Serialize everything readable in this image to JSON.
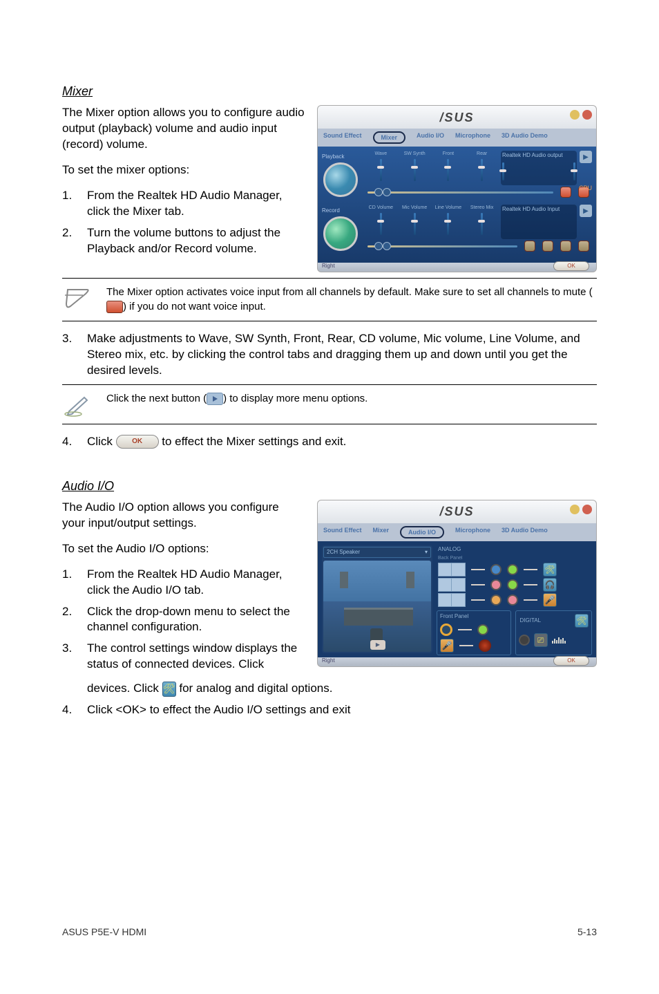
{
  "sections": {
    "mixer": {
      "title": "Mixer",
      "intro": "The Mixer option allows you to configure audio output (playback) volume and audio input (record) volume.",
      "to_set": "To set the mixer options:",
      "steps": [
        "From the Realtek HD Audio Manager, click the Mixer tab.",
        "Turn the volume buttons to adjust the Playback and/or Record volume."
      ],
      "note1": "The Mixer option activates voice input from all channels by default. Make sure to set all channels to mute (",
      "note1_tail": ") if you do not want voice input.",
      "step3": "Make adjustments to Wave, SW Synth, Front, Rear, CD volume, Mic volume, Line Volume, and Stereo mix, etc. by clicking the control tabs and dragging them up and down until you get the desired levels.",
      "note2": "Click the next button (",
      "note2_tail": ") to display more menu options.",
      "step4a": "Click ",
      "step4b": " to effect the Mixer settings and exit."
    },
    "audio_io": {
      "title": "Audio I/O",
      "intro": "The Audio I/O option allows you configure your input/output settings.",
      "to_set": "To set the Audio I/O options:",
      "steps": [
        "From the Realtek HD Audio Manager, click the Audio I/O tab.",
        "Click the drop-down menu to select the channel configuration.",
        "The control settings window displays the status of connected devices. Click ",
        "Click <OK> to effect the Audio I/O settings and exit"
      ],
      "step3_tail": " for analog and digital options."
    }
  },
  "app": {
    "logo": "/SUS",
    "mixer_window": {
      "tabs": [
        "Sound Effect",
        "Mixer",
        "Audio I/O",
        "Microphone",
        "3D Audio Demo"
      ],
      "playback_label": "Playback",
      "record_label": "Record",
      "playback_cols": [
        "Wave",
        "SW Synth",
        "Front",
        "Rear"
      ],
      "playback_box_right": "Realtek HD Audio output",
      "record_cols": [
        "CD Volume",
        "Mic Volume",
        "Line Volume",
        "Stereo Mix"
      ],
      "record_box_right": "Realtek HD Audio Input",
      "cpu": "CPU",
      "footer_left": "Right",
      "ok": "OK"
    },
    "audio_io_window": {
      "tabs": [
        "Sound Effect",
        "Mixer",
        "Audio I/O",
        "Microphone",
        "3D Audio Demo"
      ],
      "dropdown": "2CH Speaker",
      "analog_label": "ANALOG",
      "back_panel": "Back Panel",
      "front_panel": "Front Panel",
      "digital_label": "DIGITAL",
      "footer_left": "Right",
      "ok": "OK"
    }
  },
  "footer": {
    "left": "ASUS P5E-V HDMI",
    "right": "5-13"
  },
  "labels": {
    "ok_inline": "OK"
  }
}
